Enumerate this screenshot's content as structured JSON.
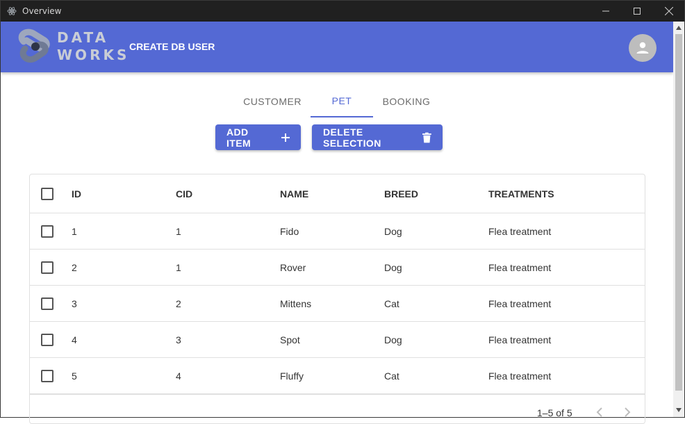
{
  "window": {
    "title": "Overview"
  },
  "header": {
    "logo_line1": "DATA",
    "logo_line2": "WORKS",
    "create_link": "CREATE DB USER",
    "brand_color": "#5469d4"
  },
  "tabs": [
    {
      "label": "CUSTOMER",
      "active": false
    },
    {
      "label": "PET",
      "active": true
    },
    {
      "label": "BOOKING",
      "active": false
    }
  ],
  "actions": {
    "add_label": "ADD ITEM",
    "delete_label": "DELETE SELECTION"
  },
  "table": {
    "columns": [
      "ID",
      "CID",
      "NAME",
      "BREED",
      "TREATMENTS"
    ],
    "rows": [
      {
        "id": "1",
        "cid": "1",
        "name": "Fido",
        "breed": "Dog",
        "treatments": "Flea treatment"
      },
      {
        "id": "2",
        "cid": "1",
        "name": "Rover",
        "breed": "Dog",
        "treatments": "Flea treatment"
      },
      {
        "id": "3",
        "cid": "2",
        "name": "Mittens",
        "breed": "Cat",
        "treatments": "Flea treatment"
      },
      {
        "id": "4",
        "cid": "3",
        "name": "Spot",
        "breed": "Dog",
        "treatments": "Flea treatment"
      },
      {
        "id": "5",
        "cid": "4",
        "name": "Fluffy",
        "breed": "Cat",
        "treatments": "Flea treatment"
      }
    ],
    "pagination": "1–5 of 5"
  },
  "icons": {
    "app": "electron-icon",
    "add": "plus-icon",
    "delete": "trash-icon",
    "avatar": "person-icon",
    "prev": "chevron-left-icon",
    "next": "chevron-right-icon"
  }
}
